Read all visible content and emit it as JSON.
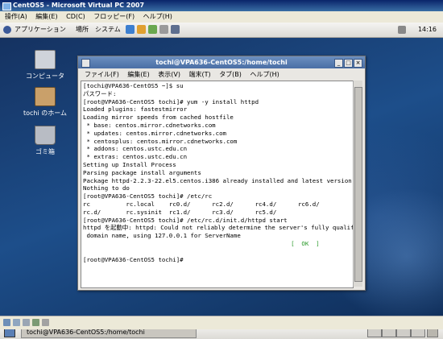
{
  "host_window": {
    "title": "CentOS5 - Microsoft Virtual PC 2007",
    "menu": [
      "操作(A)",
      "編集(E)",
      "CD(C)",
      "フロッピー(F)",
      "ヘルプ(H)"
    ]
  },
  "panel": {
    "menus": [
      "アプリケーション",
      "場所",
      "システム"
    ],
    "clock": "14:16"
  },
  "desktop_icons": [
    {
      "label": "コンピュータ"
    },
    {
      "label": "tochi のホーム"
    },
    {
      "label": "ゴミ箱"
    }
  ],
  "terminal": {
    "title": "tochi@VPA636-CentOS5:/home/tochi",
    "menu": [
      "ファイル(F)",
      "編集(E)",
      "表示(V)",
      "端末(T)",
      "タブ(B)",
      "ヘルプ(H)"
    ],
    "lines": [
      "[tochi@VPA636-CentOS5 ~]$ su",
      "パスワード:",
      "[root@VPA636-CentOS5 tochi]# yum -y install httpd",
      "Loaded plugins: fastestmirror",
      "Loading mirror speeds from cached hostfile",
      " * base: centos.mirror.cdnetworks.com",
      " * updates: centos.mirror.cdnetworks.com",
      " * centosplus: centos.mirror.cdnetworks.com",
      " * addons: centos.ustc.edu.cn",
      " * extras: centos.ustc.edu.cn",
      "Setting up Install Process",
      "Parsing package install arguments",
      "Package httpd-2.2.3-22.el5.centos.i386 already installed and latest version",
      "Nothing to do",
      "[root@VPA636-CentOS5 tochi]# /etc/rc",
      "rc          rc.local    rc0.d/      rc2.d/      rc4.d/      rc6.d/",
      "rc.d/       rc.sysinit  rc1.d/      rc3.d/      rc5.d/",
      "[root@VPA636-CentOS5 tochi]# /etc/rc.d/init.d/httpd start",
      "httpd を起動中: httpd: Could not reliably determine the server's fully qualified",
      " domain name, using 127.0.0.1 for ServerName",
      "                                                          [  OK  ]",
      "[root@VPA636-CentOS5 tochi]#"
    ]
  },
  "taskbar": {
    "task": "tochi@VPA636-CentOS5:/home/tochi"
  }
}
